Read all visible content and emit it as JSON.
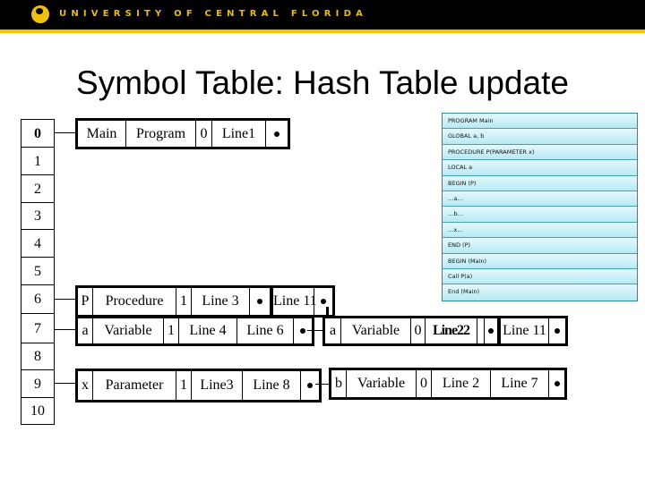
{
  "header": {
    "wordmark": "UNIVERSITY OF CENTRAL FLORIDA",
    "accent": "#f5c400"
  },
  "title": "Symbol Table: Hash Table update",
  "hash_indices": [
    "0",
    "1",
    "2",
    "3",
    "4",
    "5",
    "6",
    "7",
    "8",
    "9",
    "10"
  ],
  "records": [
    {
      "id": "main",
      "cells": [
        "Main",
        "Program",
        "0",
        "Line1",
        ""
      ]
    },
    {
      "id": "p",
      "cells": [
        "P",
        "Procedure",
        "1",
        "Line 3",
        "",
        "Line 11",
        ""
      ]
    },
    {
      "id": "a-local",
      "cells": [
        "a",
        "Variable",
        "1",
        "Line 4",
        "Line 6",
        ""
      ]
    },
    {
      "id": "a-global",
      "cells": [
        "a",
        "Variable",
        "0",
        "Line22",
        "",
        "",
        "Line 11",
        ""
      ]
    },
    {
      "id": "x",
      "cells": [
        "x",
        "Parameter",
        "1",
        "Line3",
        "Line 8",
        ""
      ]
    },
    {
      "id": "b",
      "cells": [
        "b",
        "Variable",
        "0",
        "Line 2",
        "Line 7",
        ""
      ]
    }
  ],
  "code_lines": [
    "PROGRAM Main",
    "GLOBAL a, b",
    "PROCEDURE P(PARAMETER x)",
    "LOCAL a",
    "BEGIN (P)",
    "…a…",
    "…b…",
    "…x…",
    "END (P)",
    "BEGIN (Main)",
    "Call P(a)",
    "End (Main)"
  ]
}
